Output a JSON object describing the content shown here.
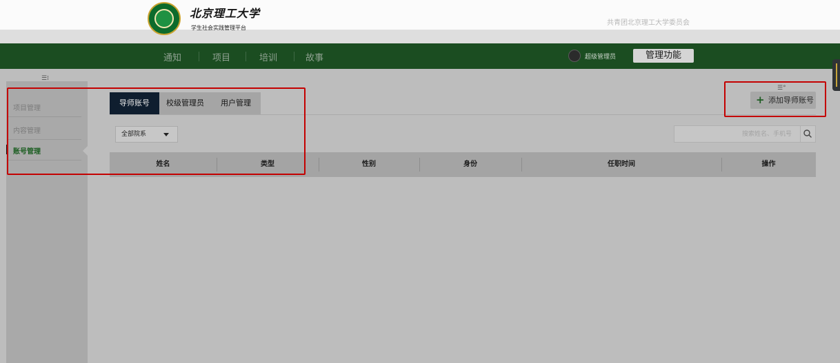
{
  "header": {
    "university_name": "北京理工大学",
    "platform_name": "学生社会实践管理平台",
    "league_name": "共青团北京理工大学委员会"
  },
  "nav": {
    "items": [
      {
        "label": "通知"
      },
      {
        "label": "项目"
      },
      {
        "label": "培训"
      },
      {
        "label": "故事"
      }
    ],
    "user_role": "超级管理员",
    "manage_button": "管理功能"
  },
  "sidebar": {
    "items": [
      {
        "label": "项目管理",
        "active": false
      },
      {
        "label": "内容管理",
        "active": false
      },
      {
        "label": "账号管理",
        "active": true
      }
    ]
  },
  "tabs": [
    {
      "label": "导师账号",
      "active": true
    },
    {
      "label": "校级管理员",
      "active": false
    },
    {
      "label": "用户管理",
      "active": false
    }
  ],
  "filter": {
    "department_selected": "全部院系"
  },
  "search": {
    "placeholder": "搜索姓名、手机号"
  },
  "add_button": {
    "label": "添加导师账号"
  },
  "table": {
    "columns": [
      "姓名",
      "类型",
      "性别",
      "身份",
      "任职时间",
      "操作"
    ],
    "rows": []
  },
  "colors": {
    "nav_background": "#1b4d21",
    "active_tab": "#0f1e2f",
    "annotation_red": "#c40000",
    "sidebar_active_text": "#1c5e22"
  },
  "icons": {
    "logo": "university-logo",
    "avatar": "user-avatar",
    "search": "search-icon",
    "plus": "plus-icon",
    "caret": "caret-down-icon"
  }
}
